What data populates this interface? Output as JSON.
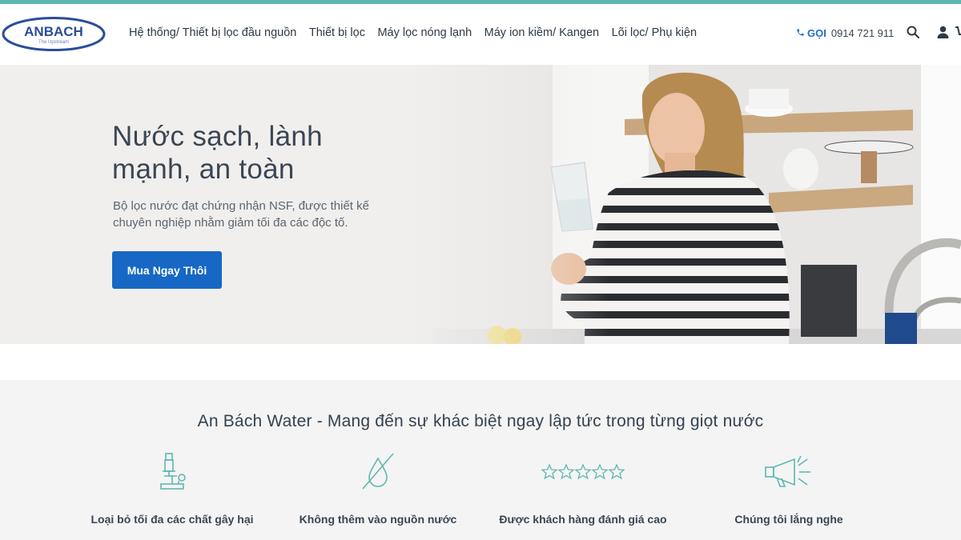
{
  "brand": {
    "logo_text": "ANBACH",
    "logo_tagline": "The Upstream"
  },
  "nav": {
    "items": [
      {
        "label": "Hệ thống/ Thiết bị lọc đầu nguồn"
      },
      {
        "label": "Thiết bị lọc"
      },
      {
        "label": "Máy lọc nóng lạnh"
      },
      {
        "label": "Máy ion kiềm/ Kangen"
      },
      {
        "label": "Lõi lọc/ Phụ kiện"
      }
    ]
  },
  "contact": {
    "call_label": "GỌI",
    "phone": "0914 721 911"
  },
  "hero": {
    "title": "Nước sạch, lành mạnh, an toàn",
    "subtitle": "Bộ lọc nước đạt chứng nhận NSF, được thiết kế chuyên nghiệp nhằm giảm tối đa các độc tố.",
    "cta_label": "Mua Ngay Thôi"
  },
  "features": {
    "title": "An Bách Water - Mang đến sự khác biệt ngay lập tức trong từng giọt nước",
    "items": [
      {
        "label": "Loại bỏ tối đa các chất gây hại",
        "icon": "microscope-icon"
      },
      {
        "label": "Không thêm vào nguồn nước",
        "icon": "no-drop-icon"
      },
      {
        "label": "Được khách hàng đánh giá cao",
        "icon": "five-stars-icon"
      },
      {
        "label": "Chúng tôi lắng nghe",
        "icon": "megaphone-icon"
      }
    ]
  },
  "colors": {
    "accent": "#1668c4",
    "top_stripe": "#5fb7b1",
    "text_dark": "#3a4654",
    "icon_teal": "#5fb7b1"
  }
}
